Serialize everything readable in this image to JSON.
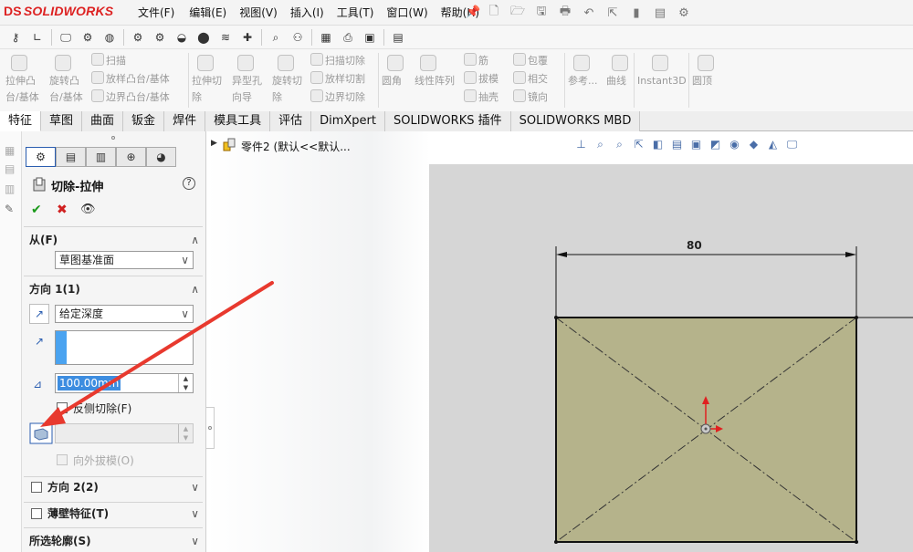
{
  "app": {
    "logo_text": "SOLIDWORKS",
    "logo_ds": "DS"
  },
  "menu": [
    "文件(F)",
    "编辑(E)",
    "视图(V)",
    "插入(I)",
    "工具(T)",
    "窗口(W)",
    "帮助(H)"
  ],
  "command_manager": {
    "features": [
      {
        "label": "拉伸凸\n台/基体"
      },
      {
        "label": "旋转凸\n台/基体"
      },
      {
        "label": "扫描"
      },
      {
        "label": "放样凸台/基体"
      },
      {
        "label": "边界凸台/基体"
      },
      {
        "label": "拉伸切\n除"
      },
      {
        "label": "异型孔\n向导"
      },
      {
        "label": "旋转切\n除"
      },
      {
        "label": "扫描切除"
      },
      {
        "label": "放样切割"
      },
      {
        "label": "边界切除"
      },
      {
        "label": "圆角"
      },
      {
        "label": "线性阵列"
      },
      {
        "label": "筋"
      },
      {
        "label": "拔模"
      },
      {
        "label": "抽壳"
      },
      {
        "label": "包覆"
      },
      {
        "label": "相交"
      },
      {
        "label": "镜向"
      },
      {
        "label": "参考..."
      },
      {
        "label": "曲线"
      },
      {
        "label": "Instant3D"
      },
      {
        "label": "圆顶"
      }
    ]
  },
  "tabs": [
    "特征",
    "草图",
    "曲面",
    "钣金",
    "焊件",
    "模具工具",
    "评估",
    "DimXpert",
    "SOLIDWORKS 插件",
    "SOLIDWORKS MBD"
  ],
  "active_tab": "特征",
  "tree": {
    "part_label": "零件2  (默认<<默认..."
  },
  "property_manager": {
    "title": "切除-拉伸",
    "help": "?",
    "from": {
      "heading": "从(F)",
      "value": "草图基准面"
    },
    "direction1": {
      "heading": "方向 1(1)",
      "end_condition": "给定深度",
      "depth": "100.00mm",
      "flip_side_label": "反侧切除(F)",
      "draft_outward_label": "向外拔模(O)"
    },
    "direction2": {
      "heading": "方向 2(2)"
    },
    "thin_feature": {
      "heading": "薄壁特征(T)"
    },
    "selected_contours": {
      "heading": "所选轮廓(S)"
    }
  },
  "sketch": {
    "dimension": "80"
  },
  "colors": {
    "logo_red": "#d22222",
    "sketch_fill": "#b5b38b",
    "viewport_bg": "#d6d6d6",
    "annotation_red": "#e8392e",
    "ok_green": "#1b9a1b"
  }
}
